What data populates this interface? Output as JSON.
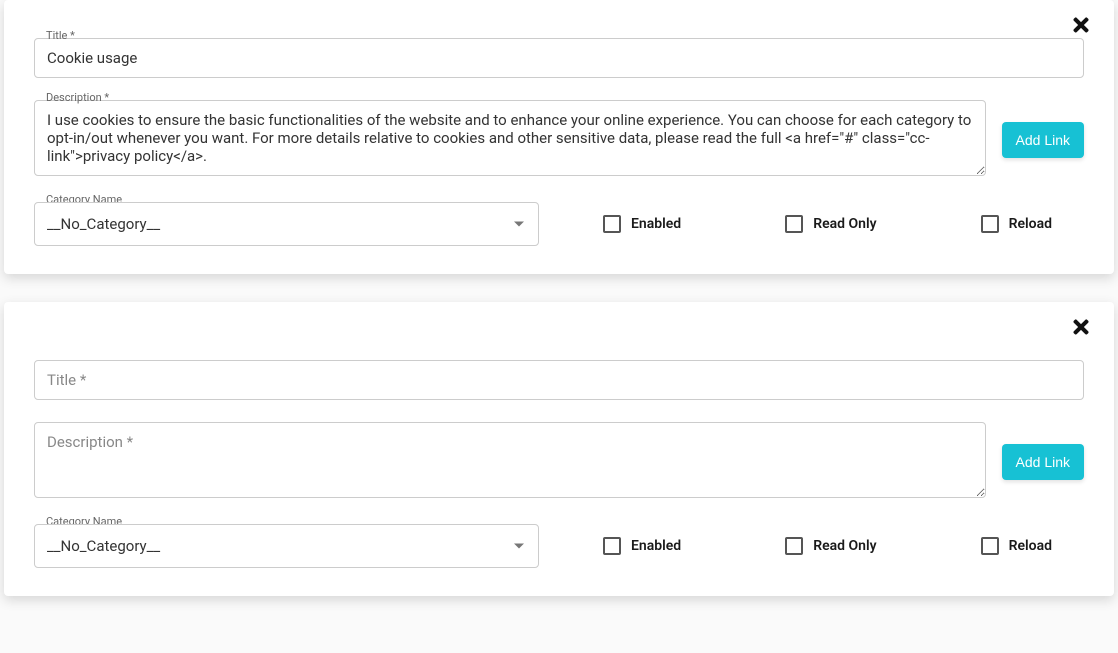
{
  "labels": {
    "title": "Title *",
    "description_label": "Description *",
    "title_placeholder": "Title *",
    "description_placeholder": "Description *",
    "category": "Category Name",
    "add_link": "Add Link",
    "enabled": "Enabled",
    "read_only": "Read Only",
    "reload": "Reload"
  },
  "blocks": [
    {
      "title": "Cookie usage",
      "description": "I use cookies to ensure the basic functionalities of the website and to enhance your online experience. You can choose for each category to opt-in/out whenever you want. For more details relative to cookies and other sensitive data, please read the full <a href=\"#\" class=\"cc-link\">privacy policy</a>.",
      "category": "__No_Category__",
      "enabled": false,
      "read_only": false,
      "reload": false
    },
    {
      "title": "",
      "description": "",
      "category": "__No_Category__",
      "enabled": false,
      "read_only": false,
      "reload": false
    }
  ]
}
